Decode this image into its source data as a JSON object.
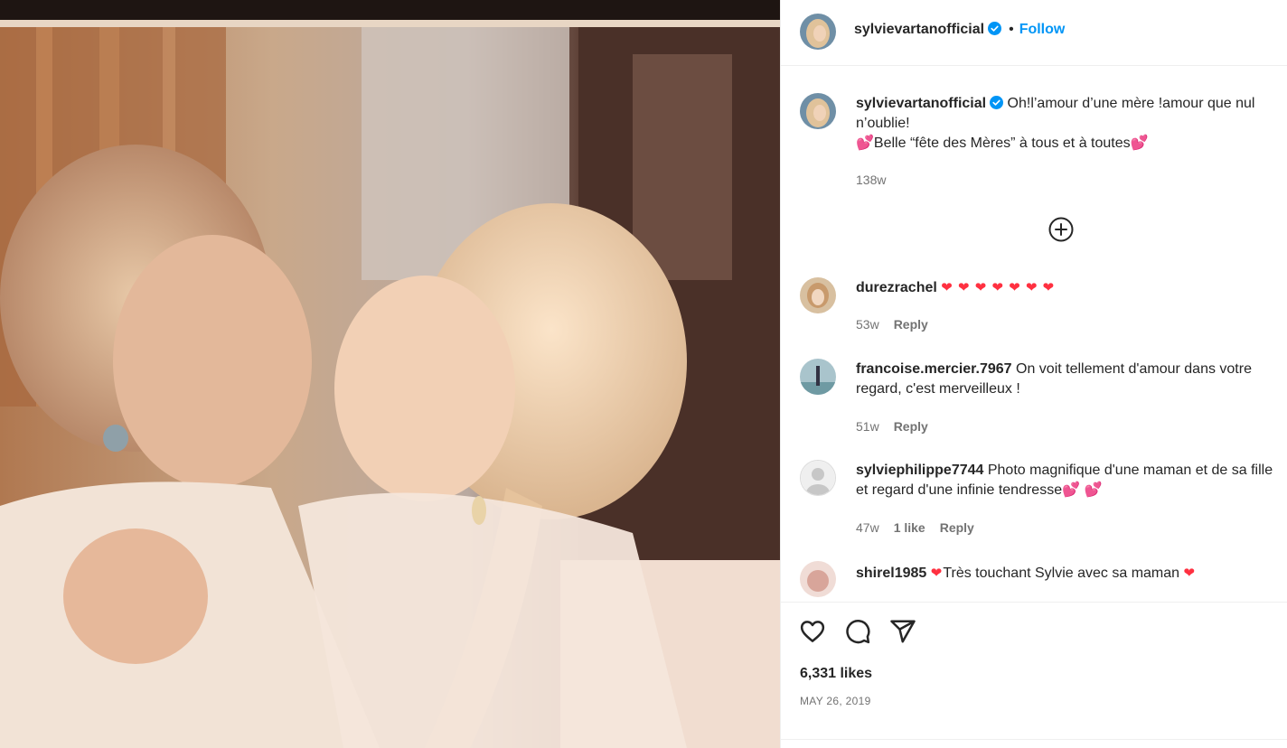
{
  "post": {
    "username": "sylvievartanofficial",
    "follow_label": "Follow",
    "dot": "•",
    "caption_line1": "Oh!l’amour d’une mère !amour que nul n’oublie!",
    "caption_line2": "Belle “fête des Mères” à tous et à toutes",
    "caption_time": "138w",
    "likes": "6,331 likes",
    "date": "MAY 26, 2019"
  },
  "comments": [
    {
      "username": "durezrachel",
      "text": "❤ ❤ ❤ ❤ ❤ ❤ ❤",
      "time": "53w",
      "reply": "Reply"
    },
    {
      "username": "francoise.mercier.7967",
      "text": "On voit tellement d'amour dans votre regard, c'est merveilleux !",
      "time": "51w",
      "reply": "Reply"
    },
    {
      "username": "sylviephilippe7744",
      "text": "Photo magnifique d'une maman et de sa fille et regard d'une infinie tendresse",
      "time": "47w",
      "likes": "1 like",
      "reply": "Reply"
    },
    {
      "username": "shirel1985",
      "text": "Très touchant Sylvie avec sa maman",
      "heart": "❤"
    }
  ],
  "icons": {
    "verified": "verified-badge-icon",
    "load_more": "plus-circle-icon",
    "like": "heart-icon",
    "comment": "comment-icon",
    "share": "share-icon"
  },
  "colors": {
    "accent": "#0095f6",
    "heart": "#ff3040",
    "muted": "#737373"
  }
}
